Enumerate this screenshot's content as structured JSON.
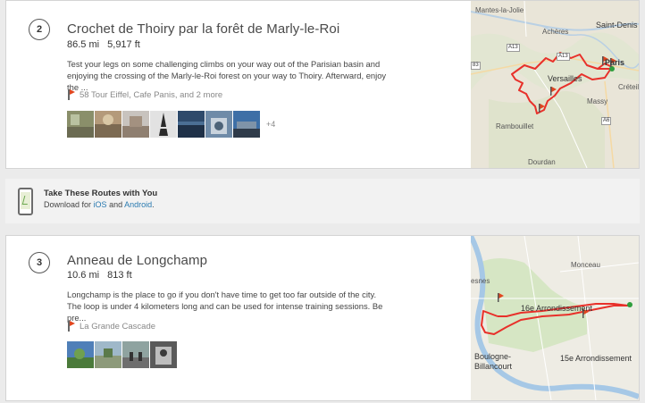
{
  "routes": [
    {
      "number": "2",
      "title": "Crochet de Thoiry par la forêt de Marly-le-Roi",
      "distance": "86.5 mi",
      "elevation": "5,917 ft",
      "description": "Test your legs on some challenging climbs on your way out of the Parisian basin and enjoying the crossing of the Marly-le-Roi forest on your way to Thoiry. Afterward, enjoy the ...",
      "pois": "58 Tour Eiffel, Cafe Panis, and 2 more",
      "photo_more": "+4",
      "map_labels": [
        "Mantes-la-Jolie",
        "Saint-Denis",
        "Achères",
        "Paris",
        "Versailles",
        "Créteil",
        "Massy",
        "Rambouillet",
        "Dourdan",
        "A13",
        "A13",
        "A6",
        "83"
      ]
    },
    {
      "number": "3",
      "title": "Anneau de Longchamp",
      "distance": "10.6 mi",
      "elevation": "813 ft",
      "description": "Longchamp is the place to go if you don't have time to get too far outside of the city. The loop is under 4 kilometers long and can be used for intense training sessions. Be pre...",
      "pois": "La Grande Cascade",
      "map_labels": [
        "Monceau",
        "esnes",
        "16e Arrondissement",
        "Boulogne-\nBillancourt",
        "15e Arrondissement"
      ]
    }
  ],
  "promo": {
    "title": "Take These Routes with You",
    "text_prefix": "Download for",
    "ios": "iOS",
    "and": "and",
    "android": "Android",
    "suffix": "."
  },
  "colors": {
    "route_line": "#e8302a",
    "link": "#2a7ab0",
    "flag": "#e0461f"
  }
}
